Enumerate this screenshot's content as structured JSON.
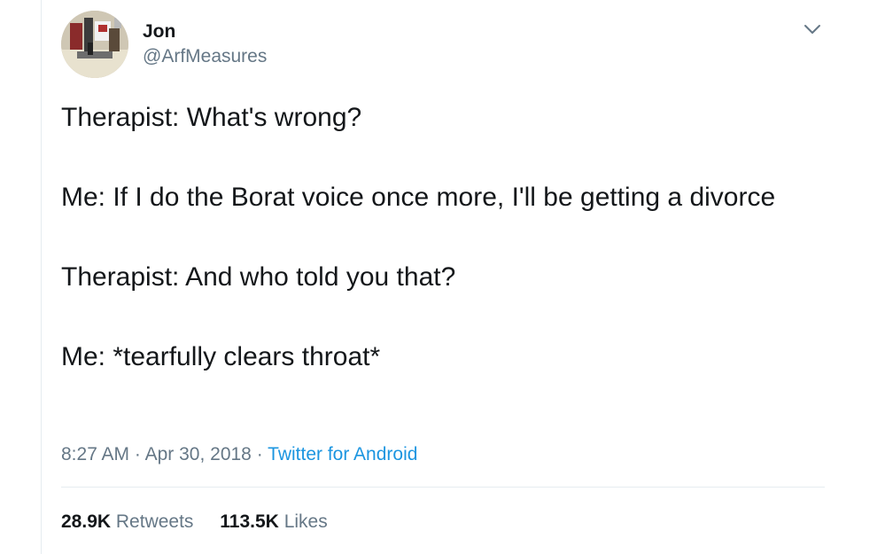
{
  "author": {
    "name": "Jon",
    "handle": "@ArfMeasures",
    "avatar_icon": "profile-photo"
  },
  "tweet": {
    "lines": [
      "Therapist: What's wrong?",
      "Me: If I do the Borat voice once more, I'll be getting a divorce",
      "Therapist: And who told you that?",
      "Me: *tearfully clears throat*"
    ]
  },
  "meta": {
    "time": "8:27 AM",
    "separator": "·",
    "date": "Apr 30, 2018",
    "source": "Twitter for Android"
  },
  "stats": {
    "retweets_count": "28.9K",
    "retweets_label": "Retweets",
    "likes_count": "113.5K",
    "likes_label": "Likes"
  },
  "icons": {
    "menu": "chevron-down-icon"
  },
  "colors": {
    "text": "#14171a",
    "secondary": "#657786",
    "link": "#1b95e0",
    "divider": "#e6ecf0"
  }
}
